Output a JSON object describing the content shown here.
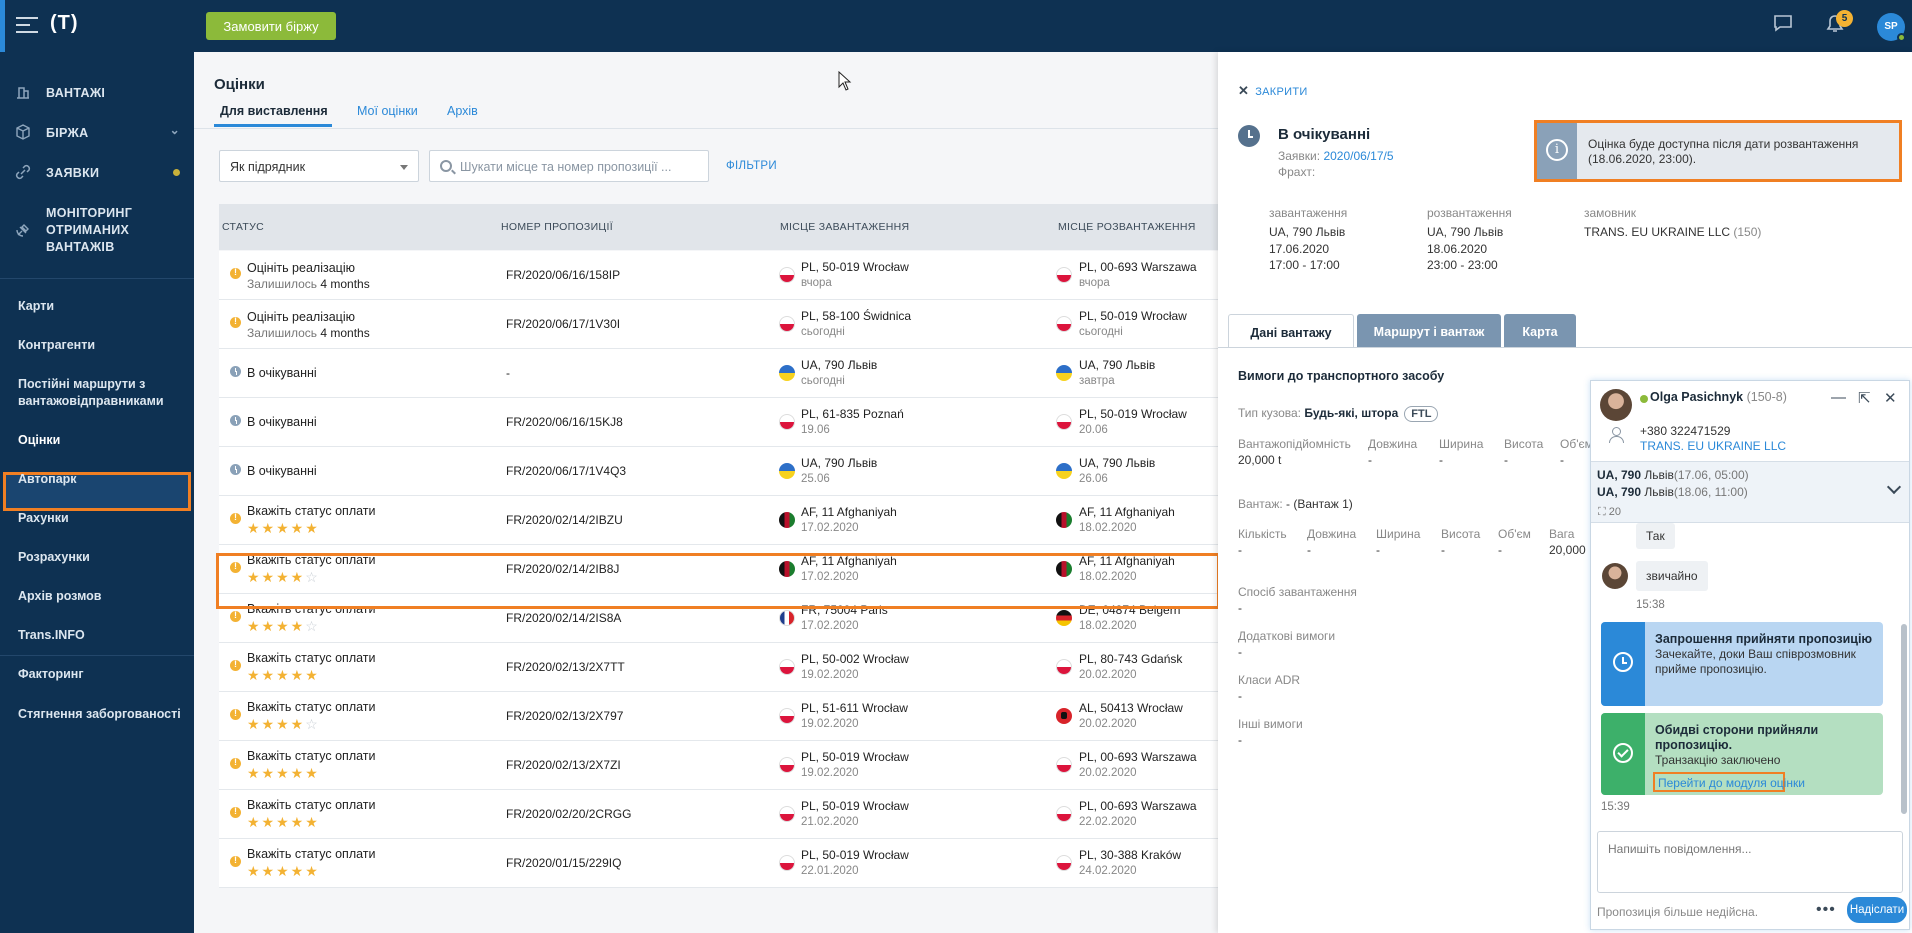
{
  "topbar": {
    "logo": "(T)",
    "order_button": "Замовити біржу",
    "notifications_count": "5",
    "avatar_initials": "SP"
  },
  "sidebar": {
    "main_items": [
      {
        "label": "ВАНТАЖІ",
        "icon": "cargo-icon"
      },
      {
        "label": "БІРЖА",
        "icon": "cube-icon"
      },
      {
        "label": "ЗАЯВКИ",
        "icon": "link-icon"
      },
      {
        "label_lines": [
          "МОНІТОРИНГ",
          "ОТРИМАНИХ",
          "ВАНТАЖІВ"
        ],
        "icon": "satellite-icon"
      }
    ],
    "items": [
      "Карти",
      "Контрагенти",
      "Постійні маршрути з",
      "вантажовідправниками",
      "Оцінки",
      "Автопарк",
      "Рахунки",
      "Розрахунки",
      "Архів розмов",
      "Trans.INFO",
      "Факторинг",
      "Стягнення заборгованості"
    ]
  },
  "main": {
    "title": "Оцінки",
    "tabs": [
      "Для виставлення",
      "Мої оцінки",
      "Архів"
    ],
    "select_value": "Як підрядник",
    "search_placeholder": "Шукати місце та номер пропозиції ...",
    "filters_label": "ФІЛЬТРИ",
    "columns": [
      "СТАТУС",
      "НОМЕР ПРОПОЗИЦІЇ",
      "МІСЦЕ ЗАВАНТАЖЕННЯ",
      "МІСЦЕ РОЗВАНТАЖЕННЯ"
    ],
    "rows": [
      {
        "status": "Оцініть реалізацію",
        "sub_prefix": "Залишилось",
        "sub_value": "4 months",
        "number": "FR/2020/06/16/158IP",
        "from": "PL, 50-019 Wrocław",
        "from_date": "вчора",
        "to": "PL, 00-693 Warszawa",
        "to_date": "вчора",
        "from_flag": "pl",
        "to_flag": "pl"
      },
      {
        "status": "Оцініть реалізацію",
        "sub_prefix": "Залишилось",
        "sub_value": "4 months",
        "number": "FR/2020/06/17/1V30I",
        "from": "PL, 58-100 Świdnica",
        "from_date": "сьогодні",
        "to": "PL, 50-019 Wrocław",
        "to_date": "сьогодні",
        "from_flag": "pl",
        "to_flag": "pl"
      },
      {
        "status": "В очікуванні",
        "number": "-",
        "from": "UA, 790 Львів",
        "from_date": "сьогодні",
        "to": "UA, 790 Львів",
        "to_date": "завтра",
        "from_flag": "ua",
        "to_flag": "ua"
      },
      {
        "status": "В очікуванні",
        "number": "FR/2020/06/16/15KJ8",
        "from": "PL, 61-835 Poznań",
        "from_date": "19.06",
        "to": "PL, 50-019 Wrocław",
        "to_date": "20.06",
        "from_flag": "pl",
        "to_flag": "pl"
      },
      {
        "status": "В очікуванні",
        "number": "FR/2020/06/17/1V4Q3",
        "from": "UA, 790 Львів",
        "from_date": "25.06",
        "to": "UA, 790 Львів",
        "to_date": "26.06",
        "from_flag": "ua",
        "to_flag": "ua"
      },
      {
        "status": "Вкажіть статус оплати",
        "stars": 5,
        "number": "FR/2020/02/14/2IBZU",
        "from": "AF, 11 Afghaniyah",
        "from_date": "17.02.2020",
        "to": "AF, 11 Afghaniyah",
        "to_date": "18.02.2020",
        "from_flag": "af",
        "to_flag": "af"
      },
      {
        "status": "Вкажіть статус оплати",
        "stars": 4,
        "number": "FR/2020/02/14/2IB8J",
        "from": "AF, 11 Afghaniyah",
        "from_date": "17.02.2020",
        "to": "AF, 11 Afghaniyah",
        "to_date": "18.02.2020",
        "from_flag": "af",
        "to_flag": "af"
      },
      {
        "status": "Вкажіть статус оплати",
        "stars": 4,
        "number": "FR/2020/02/14/2IS8A",
        "from": "FR, 75004 Paris",
        "from_date": "17.02.2020",
        "to": "DE, 04874 Belgern",
        "to_date": "18.02.2020",
        "from_flag": "fr",
        "to_flag": "de"
      },
      {
        "status": "Вкажіть статус оплати",
        "stars": 5,
        "number": "FR/2020/02/13/2X7TT",
        "from": "PL, 50-002 Wrocław",
        "from_date": "19.02.2020",
        "to": "PL, 80-743 Gdańsk",
        "to_date": "20.02.2020",
        "from_flag": "pl",
        "to_flag": "pl"
      },
      {
        "status": "Вкажіть статус оплати",
        "stars": 4,
        "number": "FR/2020/02/13/2X797",
        "from": "PL, 51-611 Wrocław",
        "from_date": "19.02.2020",
        "to": "AL, 50413 Wrocław",
        "to_date": "20.02.2020",
        "from_flag": "pl",
        "to_flag": "al"
      },
      {
        "status": "Вкажіть статус оплати",
        "stars": 5,
        "number": "FR/2020/02/13/2X7ZI",
        "from": "PL, 50-019 Wrocław",
        "from_date": "19.02.2020",
        "to": "PL, 00-693 Warszawa",
        "to_date": "20.02.2020",
        "from_flag": "pl",
        "to_flag": "pl"
      },
      {
        "status": "Вкажіть статус оплати",
        "stars": 5,
        "number": "FR/2020/02/20/2CRGG",
        "from": "PL, 50-019 Wrocław",
        "from_date": "21.02.2020",
        "to": "PL, 00-693 Warszawa",
        "to_date": "22.02.2020",
        "from_flag": "pl",
        "to_flag": "pl"
      },
      {
        "status": "Вкажіть статус оплати",
        "stars": 5,
        "number": "FR/2020/01/15/229IQ",
        "from": "PL, 50-019 Wrocław",
        "from_date": "22.01.2020",
        "to": "PL, 30-388 Kraków",
        "to_date": "24.02.2020",
        "from_flag": "pl",
        "to_flag": "pl"
      }
    ]
  },
  "panel": {
    "close_label": "ЗАКРИТИ",
    "status_title": "В очікуванні",
    "orders_label": "Заявки:",
    "orders_value": "2020/06/17/5",
    "freight_label": "Фрахт:",
    "info_text": "Оцінка буде доступна після дати розвантаження (18.06.2020, 23:00).",
    "loading_label": "завантаження",
    "loading_lines": [
      "UA, 790 Львів",
      "17.06.2020",
      "17:00 - 17:00"
    ],
    "unloading_label": "розвантаження",
    "unloading_lines": [
      "UA, 790 Львів",
      "18.06.2020",
      "23:00 - 23:00"
    ],
    "customer_label": "замовник",
    "customer_name": "TRANS. EU UKRAINE LLC",
    "customer_id": "(150)",
    "tabs": [
      "Дані вантажу",
      "Маршрут і вантаж",
      "Карта"
    ],
    "vehicle_section": "Вимоги до транспортного засобу",
    "body_type_label": "Тип кузова:",
    "body_type_value": "Будь-які, штора",
    "ftl": "FTL",
    "vehicle_cols": [
      "Вантажопідйомність",
      "Довжина",
      "Ширина",
      "Висота",
      "Об'єм"
    ],
    "vehicle_vals": [
      "20,000 t",
      "-",
      "-",
      "-",
      "-"
    ],
    "cargo_label": "Вантаж:",
    "cargo_value": "- (Вантаж 1)",
    "cargo_cols": [
      "Кількість",
      "Довжина",
      "Ширина",
      "Висота",
      "Об'єм",
      "Вага"
    ],
    "cargo_vals": [
      "-",
      "-",
      "-",
      "-",
      "-",
      "20,000"
    ],
    "loading_method_label": "Спосіб завантаження",
    "loading_method_value": "-",
    "extra_req_label": "Додаткові вимоги",
    "extra_req_value": "-",
    "adr_label": "Класи ADR",
    "adr_value": "-",
    "other_req_label": "Інші вимоги",
    "other_req_value": "-"
  },
  "chat": {
    "name": "Olga Pasichnyk",
    "name_id": "(150-8)",
    "phone": "+380 322471529",
    "company": "TRANS. EU UKRAINE LLC",
    "route_from_bold": "UA, 790",
    "route_from_city": "Львів",
    "route_from_time": "(17.06, 05:00)",
    "route_to_bold": "UA, 790",
    "route_to_city": "Львів",
    "route_to_time": "(18.06, 11:00)",
    "route_count": "20",
    "msg_yes": "Так",
    "msg_usual": "звичайно",
    "msg_time_1": "15:38",
    "card1_title": "Запрошення прийняти пропозицію",
    "card1_text": "Зачекайте, доки Ваш співрозмовник прийме пропозицію.",
    "card2_title": "Обидві сторони прийняли пропозицію.",
    "card2_text": "Транзакцію заключено",
    "card2_link": "Перейти до модуля оцінки",
    "msg_time_2": "15:39",
    "input_placeholder": "Напишіть повідомлення...",
    "footer_text": "Пропозиція більше недійсна.",
    "send_label": "Надіслати"
  },
  "colors": {
    "sidebar": "#0e3152",
    "accent_blue": "#2b89d8",
    "highlight_orange": "#f07f23",
    "order_button": "#8cba3a",
    "star": "#f3b233"
  }
}
